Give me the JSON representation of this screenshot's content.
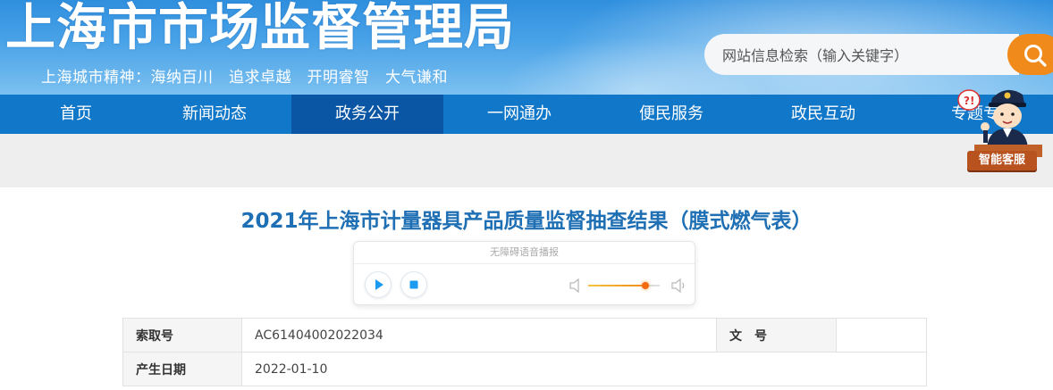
{
  "header": {
    "site_title": "上海市市场监督管理局",
    "motto": "上海城市精神：海纳百川　追求卓越　开明睿智　大气谦和",
    "search": {
      "placeholder": "网站信息检索（输入关键字）",
      "value": ""
    },
    "search_button_icon": "search-icon"
  },
  "nav": {
    "items": [
      {
        "label": "首页"
      },
      {
        "label": "新闻动态"
      },
      {
        "label": "政务公开",
        "active": true
      },
      {
        "label": "一网通办"
      },
      {
        "label": "便民服务"
      },
      {
        "label": "政民互动"
      },
      {
        "label": "专题专"
      }
    ]
  },
  "customer_service": {
    "label": "智能客服",
    "icon": "police-mascot-icon"
  },
  "article": {
    "title": "2021年上海市计量器具产品质量监督抽查结果（膜式燃气表）",
    "audio_player": {
      "header": "无障碍语音播报",
      "volume": 0.8
    },
    "info": [
      {
        "key": "索取号",
        "value": "AC61404002022034",
        "key2": "文　号",
        "value2": ""
      },
      {
        "key": "产生日期",
        "value": "2022-01-10"
      }
    ]
  },
  "colors": {
    "nav": "#1177c9",
    "nav_active": "#0a56a5",
    "search_button": "#f08a1a",
    "title": "#1f6fb4"
  }
}
